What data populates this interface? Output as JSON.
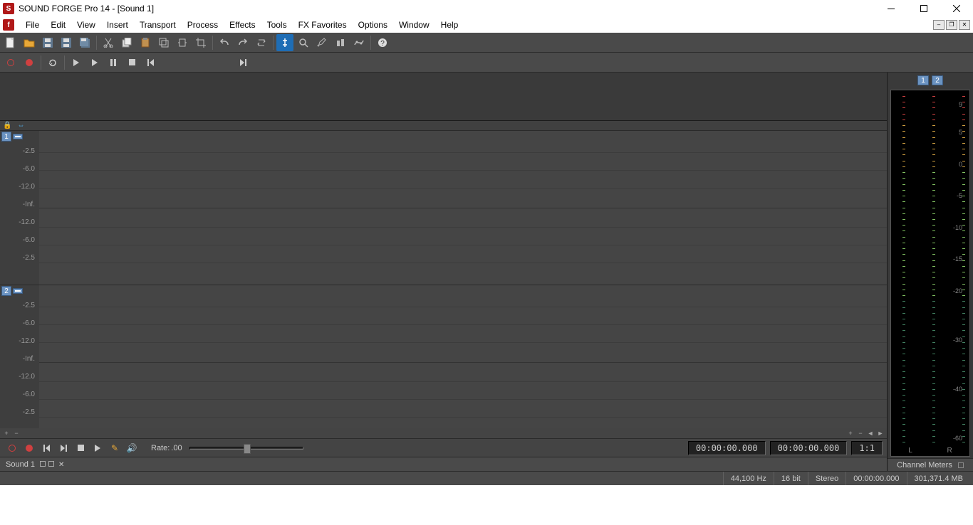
{
  "title": "SOUND FORGE Pro 14 - [Sound 1]",
  "menus": [
    "File",
    "Edit",
    "View",
    "Insert",
    "Transport",
    "Process",
    "Effects",
    "Tools",
    "FX Favorites",
    "Options",
    "Window",
    "Help"
  ],
  "channels": [
    {
      "num": "1",
      "labels": [
        "-2.5",
        "-6.0",
        "-12.0",
        "-Inf.",
        "-12.0",
        "-6.0",
        "-2.5"
      ]
    },
    {
      "num": "2",
      "labels": [
        "-2.5",
        "-6.0",
        "-12.0",
        "-Inf.",
        "-12.0",
        "-6.0",
        "-2.5"
      ]
    }
  ],
  "rate": {
    "label": "Rate:",
    "value": ".00"
  },
  "time1": "00:00:00.000",
  "time2": "00:00:00.000",
  "zoom": "1:1",
  "doc_tab": "Sound 1",
  "meter": {
    "tabs": [
      "1",
      "2"
    ],
    "scale": [
      "9",
      "5",
      "0",
      "-5",
      "-10",
      "-15",
      "-20",
      "-30",
      "-40",
      "-60"
    ],
    "L": "L",
    "R": "R",
    "title": "Channel Meters"
  },
  "status": {
    "hz": "44,100 Hz",
    "bit": "16 bit",
    "mode": "Stereo",
    "time": "00:00:00.000",
    "mb": "301,371.4 MB"
  }
}
